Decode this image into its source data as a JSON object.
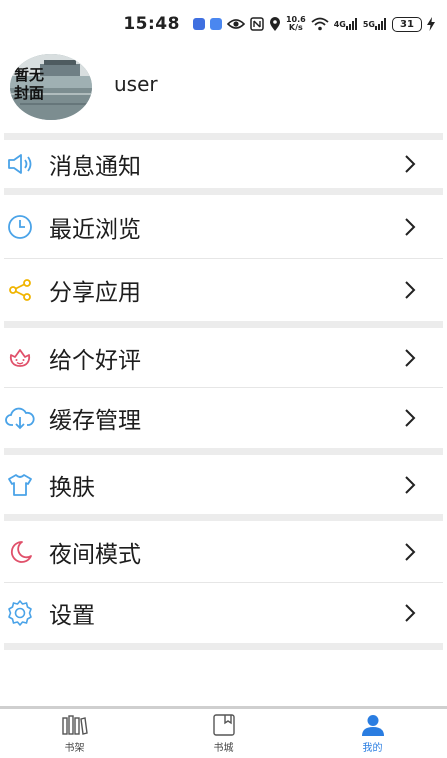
{
  "status_bar": {
    "time": "15:48",
    "net_speed_top": "10.6",
    "net_speed_bottom": "K/s",
    "signal_label_1": "4G",
    "signal_label_2": "5G",
    "battery": "31"
  },
  "profile": {
    "avatar_text": "暂无封面",
    "username": "user"
  },
  "menu": [
    {
      "label": "消息通知",
      "icon": "speaker-icon",
      "color": "#4aa3e8"
    },
    {
      "label": "最近浏览",
      "icon": "clock-icon",
      "color": "#4aa3e8"
    },
    {
      "label": "分享应用",
      "icon": "share-icon",
      "color": "#f0b400"
    },
    {
      "label": "给个好评",
      "icon": "flower-icon",
      "color": "#e0506a"
    },
    {
      "label": "缓存管理",
      "icon": "cloud-download-icon",
      "color": "#4aa3e8"
    },
    {
      "label": "换肤",
      "icon": "tshirt-icon",
      "color": "#4aa3e8"
    },
    {
      "label": "夜间模式",
      "icon": "moon-icon",
      "color": "#e0506a"
    },
    {
      "label": "设置",
      "icon": "gear-icon",
      "color": "#4aa3e8"
    }
  ],
  "bottom_nav": {
    "tabs": [
      {
        "label": "书架",
        "icon": "bookshelf-icon"
      },
      {
        "label": "书城",
        "icon": "book-store-icon"
      },
      {
        "label": "我的",
        "icon": "user-icon",
        "active": true
      }
    ],
    "active_color": "#2a7de1"
  }
}
